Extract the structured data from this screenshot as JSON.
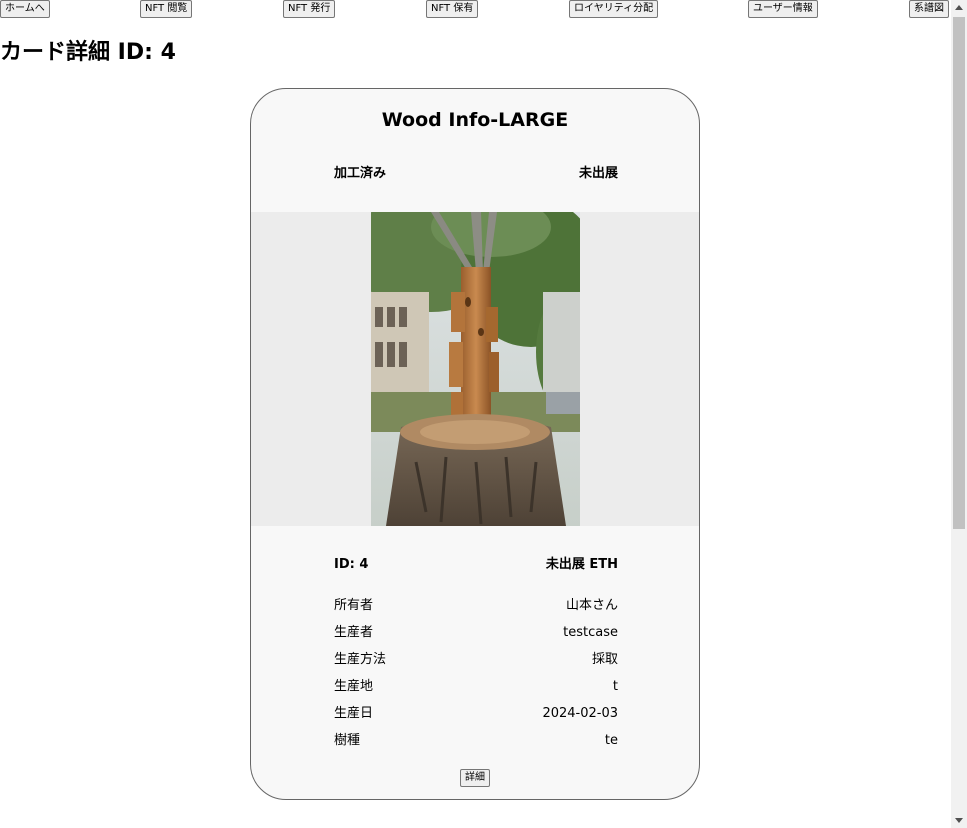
{
  "nav": {
    "home": "ホームへ",
    "browse": "NFT 閲覧",
    "issue": "NFT 発行",
    "owned": "NFT 保有",
    "royalty": "ロイヤリティ分配",
    "user": "ユーザー情報",
    "family_tree": "系譜図"
  },
  "page_title": "カード詳細 ID: 4",
  "card": {
    "title": "Wood Info-LARGE",
    "status_left": "加工済み",
    "status_right": "未出展",
    "id_label": "ID: 4",
    "price_label": "未出展 ETH",
    "fields": [
      {
        "label": "所有者",
        "value": "山本さん"
      },
      {
        "label": "生産者",
        "value": "testcase"
      },
      {
        "label": "生産方法",
        "value": "採取"
      },
      {
        "label": "生産地",
        "value": "t"
      },
      {
        "label": "生産日",
        "value": "2024-02-03"
      },
      {
        "label": "樹種",
        "value": "te"
      }
    ],
    "detail_button": "詳細"
  },
  "icons": {
    "scroll_up": "triangle-up-icon",
    "scroll_down": "triangle-down-icon"
  }
}
